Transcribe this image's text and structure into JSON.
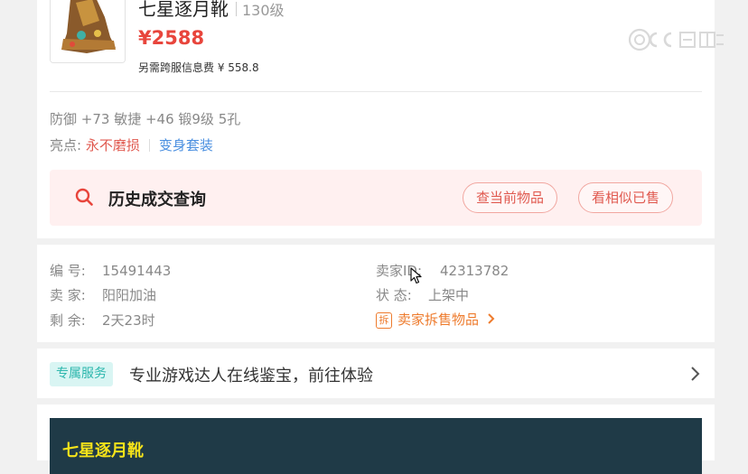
{
  "item": {
    "name": "七星逐月靴",
    "level": "130级",
    "price": "¥2588",
    "fee_note": "另需跨服信息费 ¥ 558.8",
    "attributes": "防御 +73 敏捷 +46 锻9级 5孔",
    "highlights_label": "亮点:",
    "highlight_1": "永不磨损",
    "highlight_2": "变身套装"
  },
  "history": {
    "title": "历史成交查询",
    "btn_current": "查当前物品",
    "btn_similar": "看相似已售"
  },
  "info": {
    "id_label": "编 号:",
    "id_value": "15491443",
    "seller_label": "卖 家:",
    "seller_value": "阳阳加油",
    "remain_label": "剩 余:",
    "remain_value": "2天23时",
    "seller_id_label": "卖家ID:",
    "seller_id_value": "42313782",
    "status_label": "状 态:",
    "status_value": "上架中",
    "split_icon_text": "拆",
    "split_link": "卖家拆售物品"
  },
  "service": {
    "badge": "专属服务",
    "text": "专业游戏达人在线鉴宝，前往体验"
  },
  "banner": {
    "title": "七星逐月靴"
  },
  "colors": {
    "price_red": "#e8453c",
    "accent_red": "#e05a50",
    "link_blue": "#4a8fe0",
    "link_orange": "#ee7b2d",
    "badge_teal": "#2db7ad",
    "banner_bg": "#1f3a47",
    "banner_title": "#f5e31a"
  },
  "icons": [
    "search-icon",
    "split-icon",
    "chevron-right-icon",
    "watermark-logo",
    "mouse-cursor"
  ]
}
